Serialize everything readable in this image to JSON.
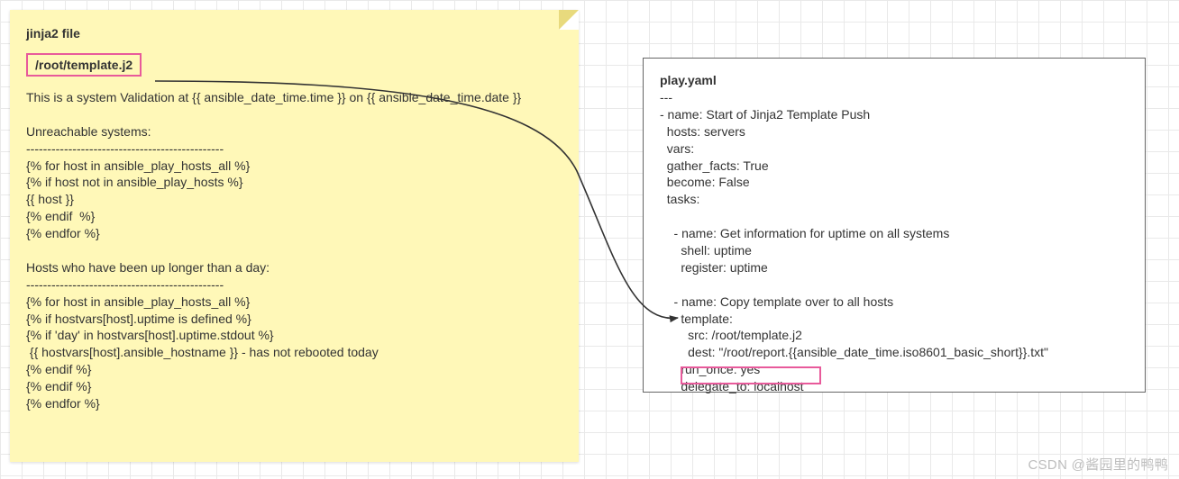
{
  "note": {
    "title": "jinja2 file",
    "filepath": "/root/template.j2",
    "body": "This is a system Validation at {{ ansible_date_time.time }} on {{ ansible_date_time.date }}\n\nUnreachable systems:\n-----------------------------------------------\n{% for host in ansible_play_hosts_all %}\n{% if host not in ansible_play_hosts %}\n{{ host }}\n{% endif  %}\n{% endfor %}\n\nHosts who have been up longer than a day:\n-----------------------------------------------\n{% for host in ansible_play_hosts_all %}\n{% if hostvars[host].uptime is defined %}\n{% if 'day' in hostvars[host].uptime.stdout %}\n {{ hostvars[host].ansible_hostname }} - has not rebooted today\n{% endif %}\n{% endif %}\n{% endfor %}"
  },
  "yaml": {
    "title": "play.yaml",
    "body": "---\n- name: Start of Jinja2 Template Push\n  hosts: servers\n  vars:\n  gather_facts: True\n  become: False\n  tasks:\n\n    - name: Get information for uptime on all systems\n      shell: uptime\n      register: uptime\n\n    - name: Copy template over to all hosts\n      template:\n        src: /root/template.j2\n        dest: \"/root/report.{{ansible_date_time.iso8601_basic_short}}.txt\"\n      run_once: yes\n      delegate_to: localhost"
  },
  "watermark": "CSDN @酱园里的鸭鸭"
}
